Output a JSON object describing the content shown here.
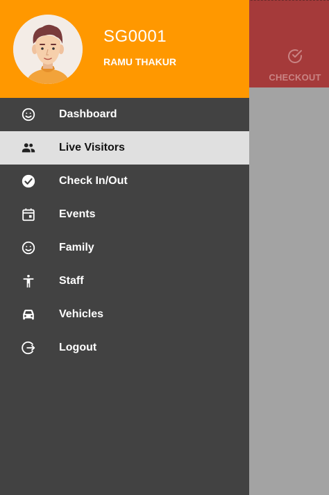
{
  "header": {
    "user_id": "SG0001",
    "user_name": "RAMU THAKUR",
    "background_color": "#ff9800"
  },
  "background_app": {
    "action_label": "CHECKOUT",
    "action_icon": "check-circle-icon",
    "topbar_color": "#a53a3a"
  },
  "menu": {
    "items": [
      {
        "label": "Dashboard",
        "icon": "smiley-icon"
      },
      {
        "label": "Live Visitors",
        "icon": "people-icon",
        "active": true
      },
      {
        "label": "Check In/Out",
        "icon": "check-circle-icon"
      },
      {
        "label": "Events",
        "icon": "calendar-icon"
      },
      {
        "label": "Family",
        "icon": "smiley-icon"
      },
      {
        "label": "Staff",
        "icon": "accessibility-icon"
      },
      {
        "label": "Vehicles",
        "icon": "car-icon"
      },
      {
        "label": "Logout",
        "icon": "logout-icon"
      }
    ]
  },
  "colors": {
    "drawer_bg": "#424242",
    "active_item_bg": "#e0e0e0",
    "scrim": "#a3a3a3"
  }
}
